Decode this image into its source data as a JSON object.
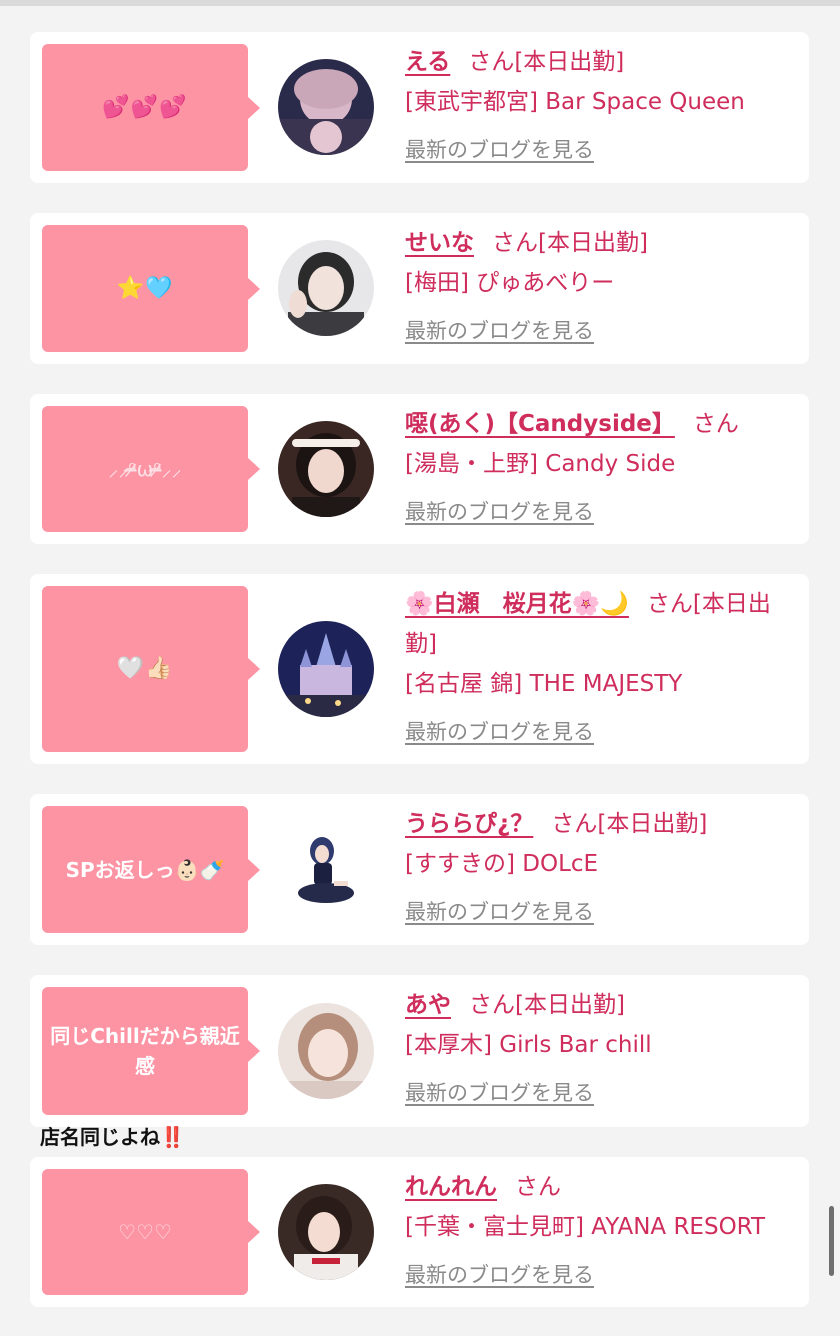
{
  "cards": [
    {
      "message": "💕💕💕",
      "name": "える",
      "suffix": "さん[本日出勤]",
      "shop": "[東武宇都宮] Bar Space Queen",
      "blog_link": "最新のブログを見る"
    },
    {
      "message": "⭐🩵",
      "name": "せいな",
      "suffix": "さん[本日出勤]",
      "shop": "[梅田] ぴゅあべりー",
      "blog_link": "最新のブログを見る"
    },
    {
      "message": "⸝⸝ᵒ̴̶̷ωᵒ̴̶̷⸝⸝",
      "name": "噁(あく)【Candyside】",
      "suffix": "さん",
      "shop": "[湯島・上野] Candy Side",
      "blog_link": "最新のブログを見る"
    },
    {
      "message": "🤍👍🏻",
      "name": "🌸白瀬　桜月花🌸🌙",
      "suffix": "さん[本日出勤]",
      "shop": "[名古屋 錦] THE MAJESTY",
      "blog_link": "最新のブログを見る"
    },
    {
      "message": "SPお返しっ👶🏻🍼",
      "name": "うららぴ¿？",
      "suffix": "さん[本日出勤]",
      "shop": "[すすきの] DOLcE",
      "blog_link": "最新のブログを見る"
    },
    {
      "message": "同じChillだから親近感",
      "name": "あや",
      "suffix": "さん[本日出勤]",
      "shop": "[本厚木] Girls Bar chill",
      "blog_link": "最新のブログを見る"
    },
    {
      "message": "♡♡♡",
      "name": "れんれん",
      "suffix": "さん",
      "shop": "[千葉・富士見町] AYANA RESORT",
      "blog_link": "最新のブログを見る"
    }
  ],
  "overlay_note": {
    "text": "店名同じよね",
    "mark": "‼️"
  },
  "colors": {
    "bubble": "#fd94a4",
    "accent": "#cf2d5c",
    "link_gray": "#8a8a8a",
    "background": "#f4f3f3"
  }
}
